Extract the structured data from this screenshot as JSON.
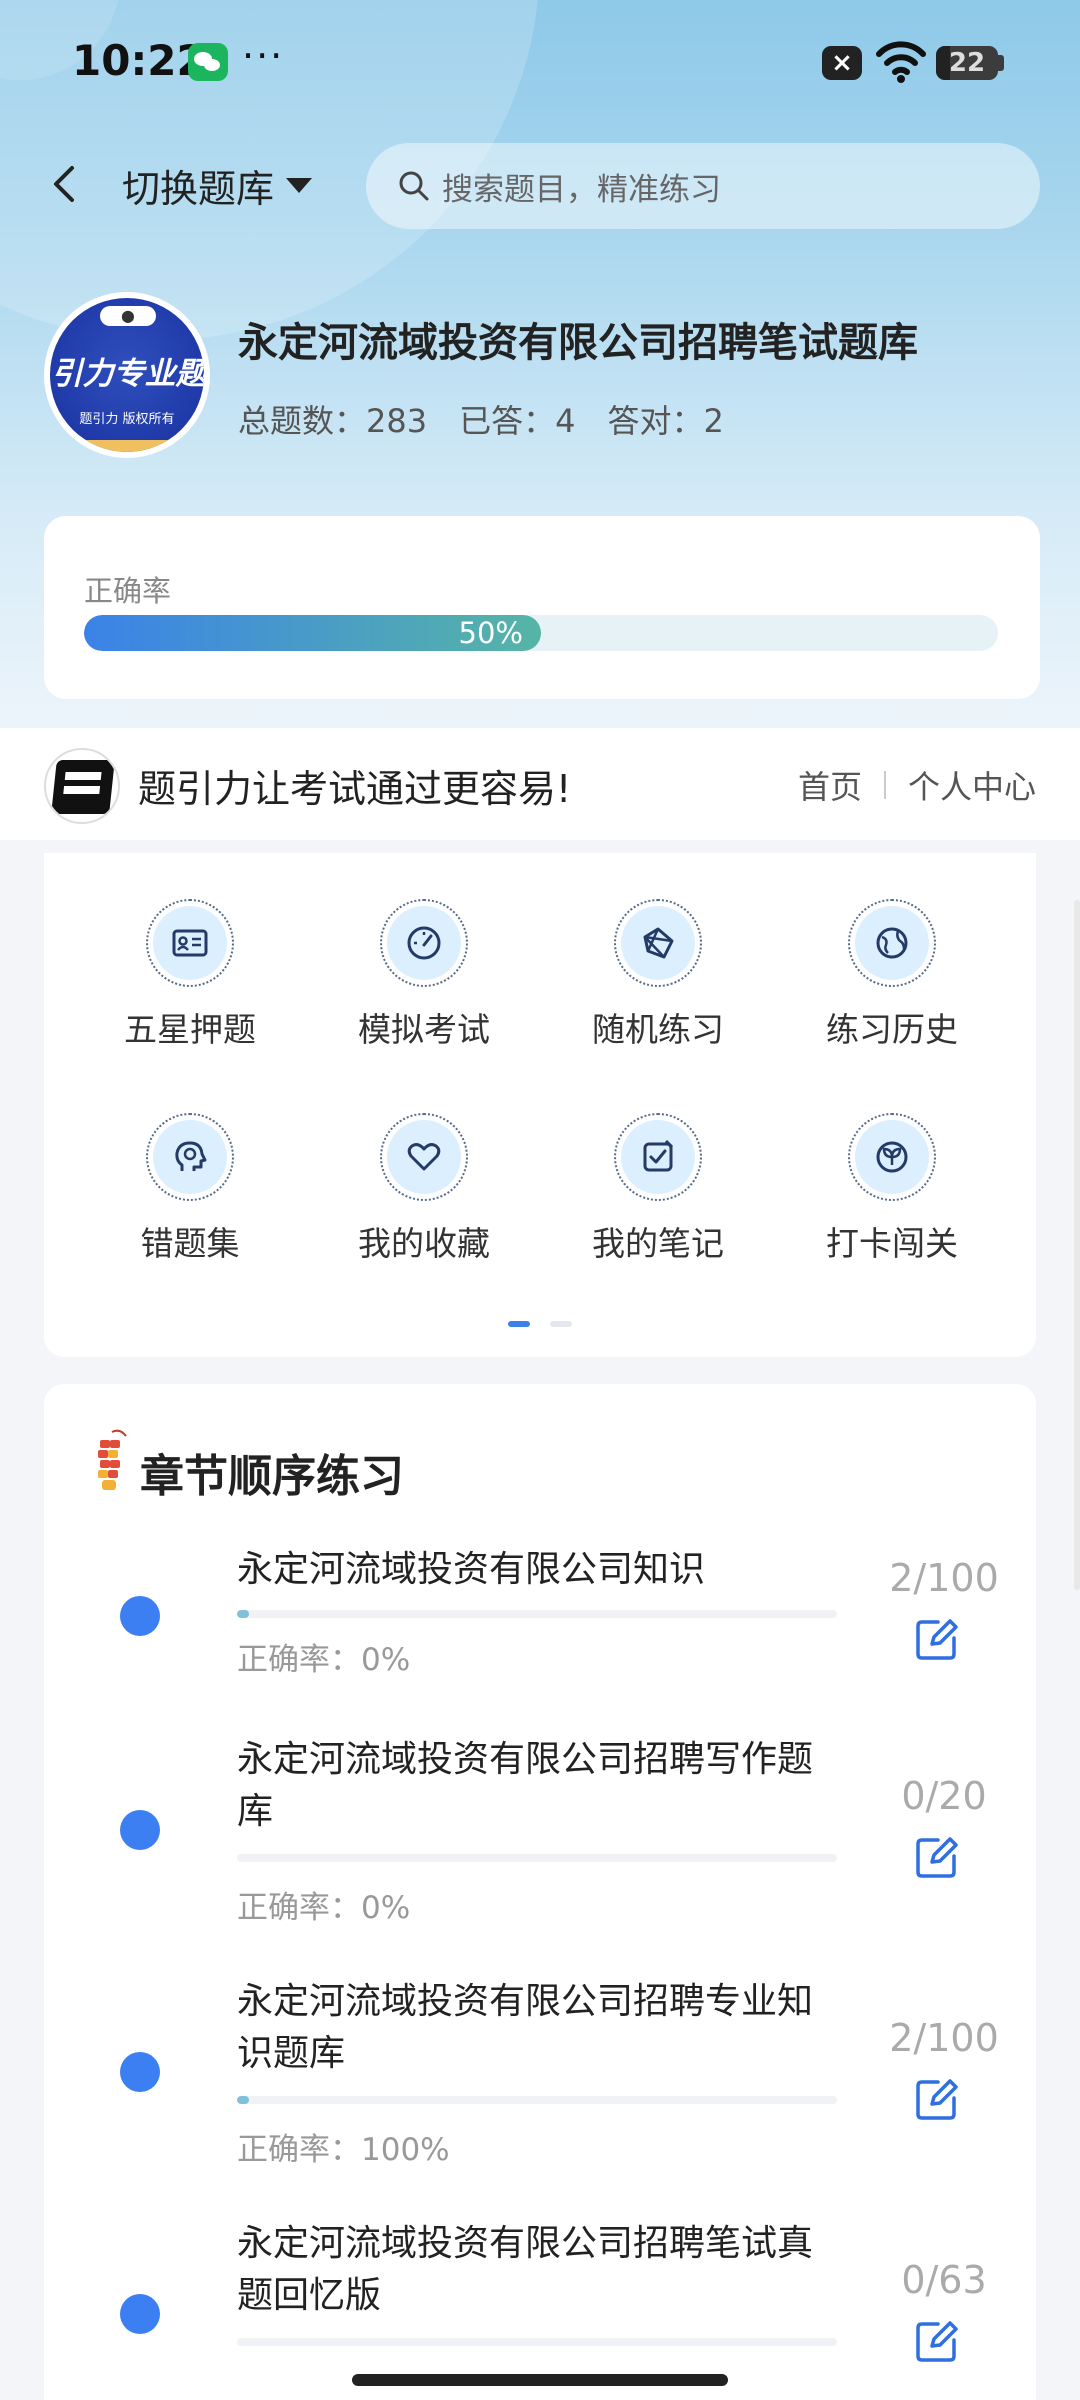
{
  "status_bar": {
    "time": "10:22",
    "more": "···",
    "battery": "22",
    "icons": [
      "wechat-icon",
      "signal-off-icon",
      "wifi-icon",
      "battery-icon"
    ]
  },
  "header": {
    "switch_label": "切换题库",
    "search_placeholder": "搜索题目，精准练习"
  },
  "bank": {
    "avatar_title": "引力专业题",
    "avatar_sub": "题引力 版权所有",
    "title": "永定河流域投资有限公司招聘笔试题库",
    "stats": [
      {
        "label": "总题数：",
        "value": "283"
      },
      {
        "label": "已答：",
        "value": "4"
      },
      {
        "label": "答对：",
        "value": "2"
      }
    ]
  },
  "accuracy": {
    "label": "正确率",
    "value_text": "50%",
    "value": 0.5
  },
  "banner": {
    "slogan": "题引力让考试通过更容易!",
    "links": [
      "首页",
      "个人中心"
    ]
  },
  "features": [
    {
      "label": "五星押题",
      "icon": "id-card-icon"
    },
    {
      "label": "模拟考试",
      "icon": "speedometer-icon"
    },
    {
      "label": "随机练习",
      "icon": "random-icon"
    },
    {
      "label": "练习历史",
      "icon": "globe-icon"
    },
    {
      "label": "错题集",
      "icon": "head-icon"
    },
    {
      "label": "我的收藏",
      "icon": "heart-icon"
    },
    {
      "label": "我的笔记",
      "icon": "note-check-icon"
    },
    {
      "label": "打卡闯关",
      "icon": "leaf-icon"
    }
  ],
  "chapter": {
    "title": "章节顺序练习",
    "items": [
      {
        "name": "永定河流域投资有限公司知识",
        "rate": "正确率：0%",
        "count": "2/100",
        "progress": 0.02
      },
      {
        "name": "永定河流域投资有限公司招聘写作题库",
        "rate": "正确率：0%",
        "count": "0/20",
        "progress": 0
      },
      {
        "name": "永定河流域投资有限公司招聘专业知识题库",
        "rate": "正确率：100%",
        "count": "2/100",
        "progress": 0.02
      },
      {
        "name": "永定河流域投资有限公司招聘笔试真题回忆版",
        "rate": "",
        "count": "0/63",
        "progress": 0
      }
    ]
  },
  "colors": {
    "accent": "#3b82e8",
    "teal": "#56b5a6",
    "dot": "#3b7ff2"
  }
}
